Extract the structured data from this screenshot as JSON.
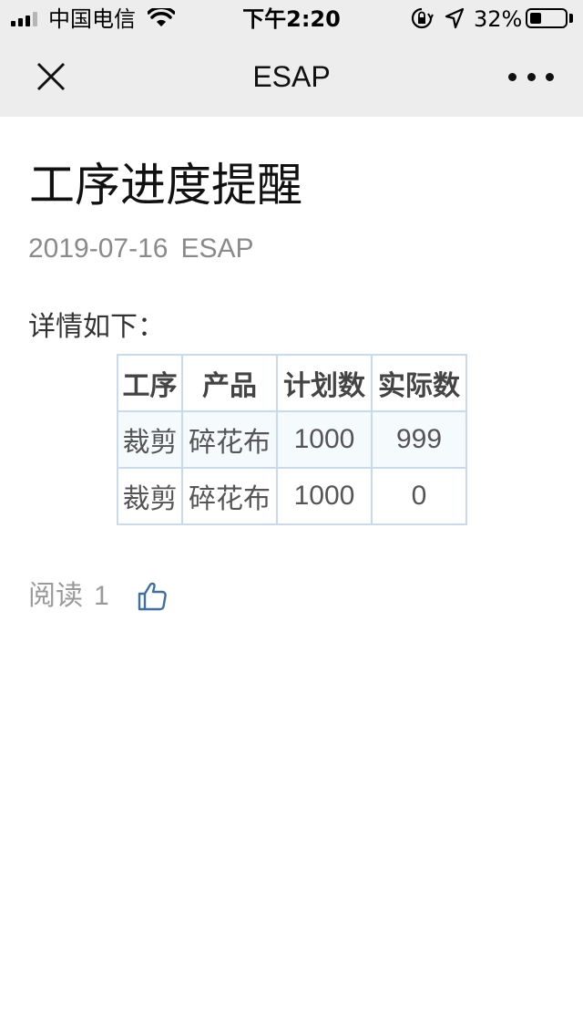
{
  "status_bar": {
    "carrier": "中国电信",
    "time": "下午2:20",
    "battery_percent": "32%",
    "battery_level": 0.32,
    "signal_bars": 3,
    "signal_bars_total": 4
  },
  "nav": {
    "title": "ESAP",
    "close_icon": "close-icon",
    "more_icon": "more-icon"
  },
  "article": {
    "title": "工序进度提醒",
    "date": "2019-07-16",
    "source": "ESAP",
    "intro": "详情如下："
  },
  "table": {
    "headers": [
      "工序",
      "产品",
      "计划数",
      "实际数"
    ],
    "rows": [
      [
        "裁剪",
        "碎花布",
        "1000",
        "999"
      ],
      [
        "裁剪",
        "碎花布",
        "1000",
        "0"
      ]
    ]
  },
  "footer": {
    "read_label": "阅读",
    "read_count": "1",
    "like_icon": "thumbs-up-icon"
  },
  "colors": {
    "bar_bg": "#ededed",
    "table_border": "#c8daed",
    "like_icon": "#3d6fa1",
    "meta_text": "#8a8a8a"
  }
}
